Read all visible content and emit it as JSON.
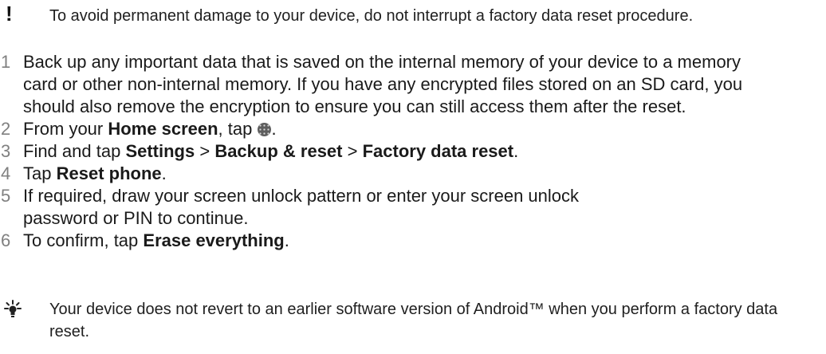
{
  "warning": {
    "icon": "exclamation-icon",
    "text": "To avoid permanent damage to your device, do not interrupt a factory data reset procedure."
  },
  "steps": [
    {
      "number": "1",
      "parts": [
        "Back up any important data that is saved on the internal memory of your device to a memory card or other non-internal memory. If you have any encrypted files stored on an SD card, you should also remove the encryption to ensure you can still access them after the reset."
      ]
    },
    {
      "number": "2",
      "parts": [
        "From your ",
        "Home screen",
        ", tap ",
        "."
      ],
      "icon": "apps-grid-icon"
    },
    {
      "number": "3",
      "parts": [
        "Find and tap ",
        "Settings",
        " > ",
        "Backup & reset",
        " > ",
        "Factory data reset",
        "."
      ]
    },
    {
      "number": "4",
      "parts": [
        "Tap ",
        "Reset phone",
        "."
      ]
    },
    {
      "number": "5",
      "parts": [
        "If required, draw your screen unlock pattern or enter your screen unlock password or PIN to continue."
      ]
    },
    {
      "number": "6",
      "parts": [
        "To confirm, tap ",
        "Erase everything",
        "."
      ]
    }
  ],
  "tip": {
    "icon": "lightbulb-icon",
    "text": "Your device does not revert to an earlier software version of Android™ when you perform a factory data reset."
  }
}
